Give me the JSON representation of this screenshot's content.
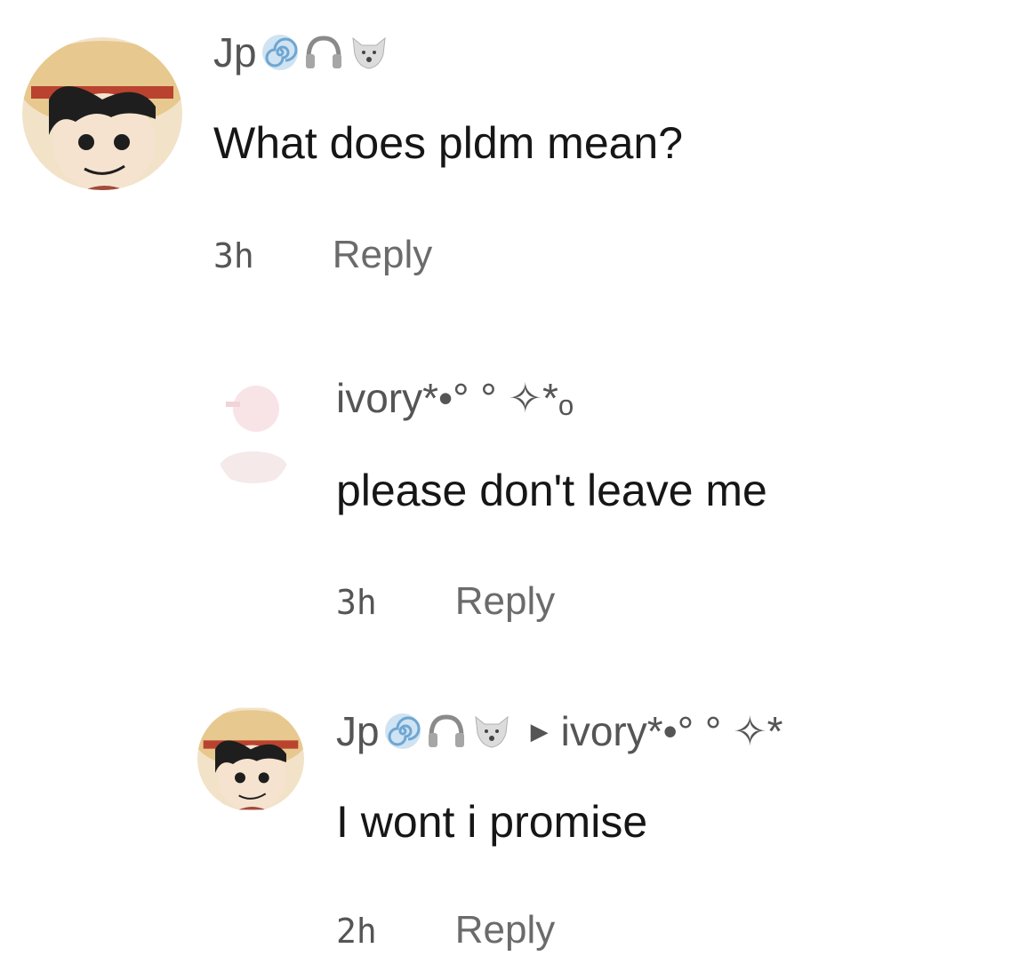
{
  "comments": [
    {
      "username": "Jp",
      "badges": [
        "spiral-icon",
        "headphones-icon",
        "wolf-icon"
      ],
      "text": "What does pldm mean?",
      "time": "3h",
      "reply_label": "Reply"
    },
    {
      "username": "ivory*•°   ° ✧*ₒ",
      "text": "please don't leave me",
      "time": "3h",
      "reply_label": "Reply"
    },
    {
      "username": "Jp",
      "badges": [
        "spiral-icon",
        "headphones-icon",
        "wolf-icon"
      ],
      "reply_to": "ivory*•°   ° ✧*",
      "text": "I wont i promise",
      "time": "2h",
      "reply_label": "Reply"
    }
  ],
  "colors": {
    "badge_blue": "#7fb0d6",
    "text": "#161616",
    "muted": "#6b6b6b"
  }
}
